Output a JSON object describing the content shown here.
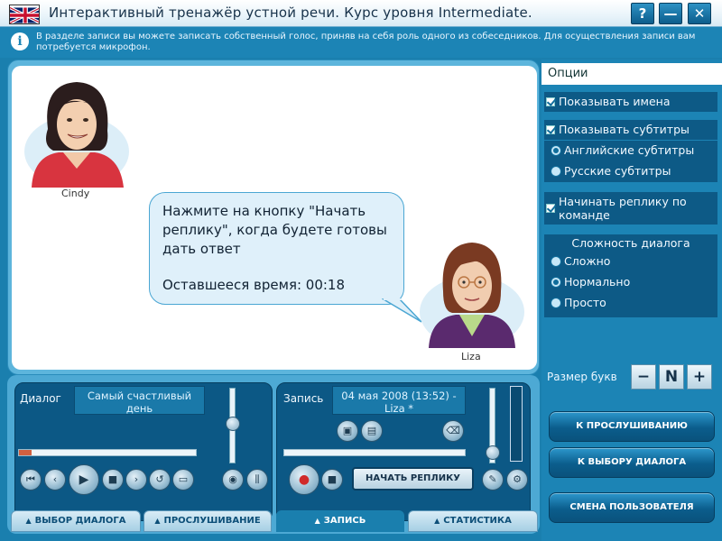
{
  "window": {
    "title": "Интерактивный тренажёр устной речи. Курс уровня Intermediate.",
    "help_label": "?",
    "minimize_label": "—",
    "close_label": "✕"
  },
  "info": {
    "icon_glyph": "i",
    "text": "В разделе записи вы можете записать собственный голос, приняв на себя роль одного из собеседников. Для осуществления записи вам потребуется микрофон."
  },
  "scene": {
    "speaker1": "Cindy",
    "speaker2": "Liza",
    "bubble_text": "Нажмите на кнопку \"Начать реплику\", когда будете готовы дать ответ",
    "bubble_time": "Оставшееся время: 00:18"
  },
  "options": {
    "title": "Опции",
    "show_names": "Показывать имена",
    "show_subtitles": "Показывать субтитры",
    "english_subtitles": "Английские субтитры",
    "russian_subtitles": "Русские субтитры",
    "start_on_command": "Начинать реплику по команде",
    "difficulty_title": "Сложность диалога",
    "difficulty_hard": "Сложно",
    "difficulty_normal": "Нормально",
    "difficulty_easy": "Просто",
    "font_size_label": "Размер букв",
    "font_minus": "−",
    "font_n": "N",
    "font_plus": "+"
  },
  "nav": {
    "to_listening": "К ПРОСЛУШИВАНИЮ",
    "to_dialog_choice": "К ВЫБОРУ ДИАЛОГА",
    "change_user": "СМЕНА ПОЛЬЗОВАТЕЛЯ"
  },
  "dialog_panel": {
    "label": "Диалог",
    "value": "Самый счастливый день",
    "progress": 0.07
  },
  "record_panel": {
    "label": "Запись",
    "value": "04 мая 2008 (13:52) - Liza *",
    "start_reply": "НАЧАТЬ РЕПЛИКУ"
  },
  "tabs": {
    "dialog_choice": "ВЫБОР ДИАЛОГА",
    "listening": "ПРОСЛУШИВАНИЕ",
    "recording": "ЗАПИСЬ",
    "statistics": "СТАТИСТИКА"
  },
  "colors": {
    "window_bg": "#1a7fae",
    "panel_dark": "#0c5885",
    "option_row": "#0d5a86"
  }
}
